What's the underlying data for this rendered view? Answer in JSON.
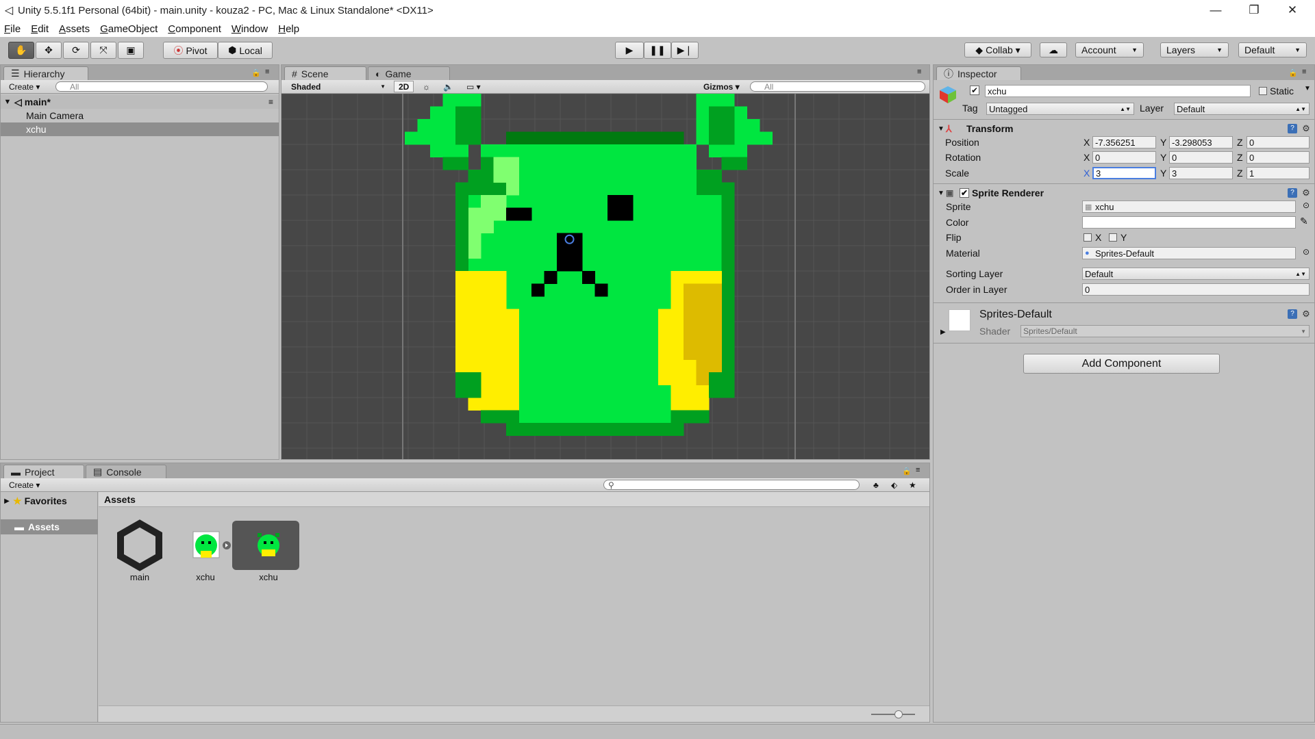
{
  "window": {
    "title": "Unity 5.5.1f1 Personal (64bit) - main.unity - kouza2 - PC, Mac & Linux Standalone* <DX11>",
    "minimize": "—",
    "maximize": "❐",
    "close": "✕"
  },
  "menu": [
    "File",
    "Edit",
    "Assets",
    "GameObject",
    "Component",
    "Window",
    "Help"
  ],
  "toolbar": {
    "pivot": "Pivot",
    "local": "Local",
    "collab": "Collab ▾",
    "account": "Account",
    "layers": "Layers",
    "layout": "Default"
  },
  "hierarchy": {
    "tab": "Hierarchy",
    "create": "Create ▾",
    "search_placeholder": "All",
    "scene": "main*",
    "items": [
      "Main Camera",
      "xchu"
    ]
  },
  "scene_view": {
    "tab_scene": "Scene",
    "tab_game": "Game",
    "shading": "Shaded",
    "mode_2d": "2D",
    "gizmos": "Gizmos ▾",
    "search_placeholder": "All"
  },
  "inspector": {
    "tab": "Inspector",
    "object_name": "xchu",
    "static_label": "Static",
    "tag_label": "Tag",
    "tag_value": "Untagged",
    "layer_label": "Layer",
    "layer_value": "Default",
    "transform": {
      "title": "Transform",
      "position_label": "Position",
      "rotation_label": "Rotation",
      "scale_label": "Scale",
      "position": {
        "x": "-7.356251",
        "y": "-3.298053",
        "z": "0"
      },
      "rotation": {
        "x": "0",
        "y": "0",
        "z": "0"
      },
      "scale": {
        "x": "3",
        "y": "3",
        "z": "1"
      }
    },
    "sprite_renderer": {
      "title": "Sprite Renderer",
      "sprite_label": "Sprite",
      "sprite_value": "xchu",
      "color_label": "Color",
      "flip_label": "Flip",
      "flip_x": "X",
      "flip_y": "Y",
      "material_label": "Material",
      "material_value": "Sprites-Default",
      "sorting_layer_label": "Sorting Layer",
      "sorting_layer_value": "Default",
      "order_label": "Order in Layer",
      "order_value": "0"
    },
    "material": {
      "name": "Sprites-Default",
      "shader_label": "Shader",
      "shader_value": "Sprites/Default"
    },
    "add_component": "Add Component"
  },
  "project": {
    "tab_project": "Project",
    "tab_console": "Console",
    "create": "Create ▾",
    "favorites": "Favorites",
    "assets_folder": "Assets",
    "breadcrumb": "Assets",
    "assets": [
      {
        "name": "main",
        "icon": "unity-scene-icon"
      },
      {
        "name": "xchu",
        "icon": "sprite-texture-icon"
      },
      {
        "name": "xchu",
        "icon": "sprite-icon"
      }
    ]
  },
  "colors": {
    "scene_bg": "#474747",
    "selection": "#3d6fcf",
    "sprite_green": "#00e640",
    "sprite_dark_green": "#009a1a",
    "sprite_yellow": "#ffee00"
  }
}
